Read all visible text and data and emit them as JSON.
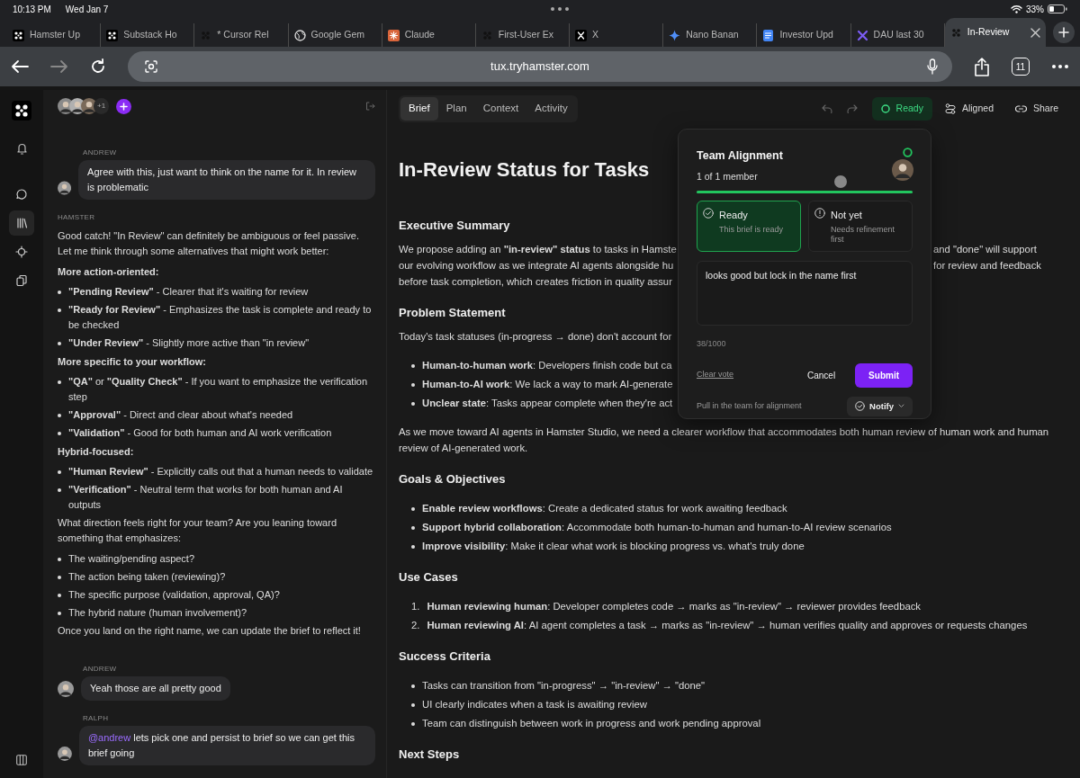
{
  "status_bar": {
    "time": "10:13 PM",
    "date": "Wed Jan 7",
    "battery": "33%"
  },
  "browser_tabs": [
    {
      "title": "Hamster Up",
      "kind": "hamster",
      "selected": false
    },
    {
      "title": "Substack Ho",
      "kind": "hamster",
      "selected": false
    },
    {
      "title": "* Cursor Rel",
      "kind": "hamster-dark",
      "selected": false
    },
    {
      "title": "Google Gem",
      "kind": "globe",
      "selected": false
    },
    {
      "title": "Claude",
      "kind": "claude",
      "selected": false
    },
    {
      "title": "First-User Ex",
      "kind": "hamster-dark",
      "selected": false
    },
    {
      "title": "X",
      "kind": "x",
      "selected": false
    },
    {
      "title": "Nano Banan",
      "kind": "gemini",
      "selected": false
    },
    {
      "title": "Investor Upd",
      "kind": "doc",
      "selected": false
    },
    {
      "title": "DAU last 30",
      "kind": "dau",
      "selected": false
    },
    {
      "title": "In-Review",
      "kind": "hamster-dark",
      "selected": true
    }
  ],
  "address_bar": {
    "url": "tux.tryhamster.com",
    "tab_count": "11"
  },
  "rail": {
    "items": [
      {
        "kind": "chat",
        "selected": false
      },
      {
        "kind": "library",
        "selected": true
      },
      {
        "kind": "target",
        "selected": false
      },
      {
        "kind": "copy",
        "selected": false
      }
    ]
  },
  "chat": {
    "extra_participants": "+1",
    "messages": [
      {
        "kind": "user",
        "author": "ANDREW",
        "text": "Agree with this, just want to think on the name for it. In review is problematic"
      },
      {
        "kind": "assistant",
        "author": "HAMSTER",
        "blocks": [
          {
            "kind": "paragraph",
            "text": "Good catch! \"In Review\" can definitely be ambiguous or feel passive. Let me think through some alternatives that might work better:"
          },
          {
            "kind": "heading",
            "text": "More action-oriented:"
          },
          {
            "kind": "bullets",
            "items": [
              "**\"Pending Review\"** - Clearer that it's waiting for review",
              "**\"Ready for Review\"** - Emphasizes the task is complete and ready to be checked",
              "**\"Under Review\"** - Slightly more active than \"in review\""
            ]
          },
          {
            "kind": "heading",
            "text": "More specific to your workflow:"
          },
          {
            "kind": "bullets",
            "items": [
              "**\"QA\"** or **\"Quality Check\"** - If you want to emphasize the verification step",
              "**\"Approval\"** - Direct and clear about what's needed",
              "**\"Validation\"** - Good for both human and AI work verification"
            ]
          },
          {
            "kind": "heading",
            "text": "Hybrid-focused:"
          },
          {
            "kind": "bullets",
            "items": [
              "**\"Human Review\"** - Explicitly calls out that a human needs to validate",
              "**\"Verification\"** - Neutral term that works for both human and AI outputs"
            ]
          },
          {
            "kind": "paragraph",
            "text": "What direction feels right for your team? Are you leaning toward something that emphasizes:"
          },
          {
            "kind": "bullets",
            "items": [
              "The waiting/pending aspect?",
              "The action being taken (reviewing)?",
              "The specific purpose (validation, approval, QA)?",
              "The hybrid nature (human involvement)?"
            ]
          },
          {
            "kind": "paragraph",
            "text": "Once you land on the right name, we can update the brief to reflect it!"
          }
        ]
      },
      {
        "kind": "user",
        "author": "ANDREW",
        "text": "Yeah those are all pretty good"
      },
      {
        "kind": "user",
        "author": "RALPH",
        "mention": "@andrew",
        "text": "lets pick one and persist to brief so we can get this brief going"
      }
    ]
  },
  "doc": {
    "tabs": [
      {
        "label": "Brief",
        "selected": true
      },
      {
        "label": "Plan",
        "selected": false
      },
      {
        "label": "Context",
        "selected": false
      },
      {
        "label": "Activity",
        "selected": false
      }
    ],
    "status_button": "Ready",
    "aligned_button": "Aligned",
    "share_button": "Share",
    "title": "In-Review Status for Tasks",
    "sections": [
      {
        "heading": "Executive Summary",
        "blocks": [
          {
            "kind": "lines",
            "lines": [
              {
                "left": "We propose adding an **\"in-review\" status** to tasks in Hamste",
                "right": "and \"done\" will support"
              },
              {
                "left": "our evolving workflow as we integrate AI agents alongside hu",
                "right": "for review and feedback"
              },
              {
                "left": "before task completion, which creates friction in quality assur"
              }
            ]
          }
        ]
      },
      {
        "heading": "Problem Statement",
        "blocks": [
          {
            "kind": "lines",
            "lines": [
              {
                "left": "Today's task statuses (in-progress → done) don't account for"
              }
            ]
          },
          {
            "kind": "bullets",
            "items": [
              "**Human-to-human work**: Developers finish code but ca",
              "**Human-to-AI work**: We lack a way to mark AI-generate",
              "**Unclear state**: Tasks appear complete when they're act"
            ]
          },
          {
            "kind": "paragraph",
            "text": "As we move toward AI agents in Hamster Studio, we need a clearer workflow that accommodates both human review of human work and human review of AI-generated work."
          }
        ]
      },
      {
        "heading": "Goals & Objectives",
        "blocks": [
          {
            "kind": "bullets",
            "items": [
              "**Enable review workflows**: Create a dedicated status for work awaiting feedback",
              "**Support hybrid collaboration**: Accommodate both human-to-human and human-to-AI review scenarios",
              "**Improve visibility**: Make it clear what work is blocking progress vs. what's truly done"
            ]
          }
        ]
      },
      {
        "heading": "Use Cases",
        "blocks": [
          {
            "kind": "numbered",
            "items": [
              {
                "number": "1.",
                "text": "**Human reviewing human**: Developer completes code → marks as \"in-review\" → reviewer provides feedback"
              },
              {
                "number": "2.",
                "text": "**Human reviewing AI**: AI agent completes a task → marks as \"in-review\" → human verifies quality and approves or requests changes"
              }
            ]
          }
        ]
      },
      {
        "heading": "Success Criteria",
        "blocks": [
          {
            "kind": "bullets",
            "items": [
              "Tasks can transition from \"in-progress\" → \"in-review\" → \"done\"",
              "UI clearly indicates when a task is awaiting review",
              "Team can distinguish between work in progress and work pending approval"
            ]
          }
        ]
      },
      {
        "heading": "Next Steps"
      }
    ]
  },
  "alignment": {
    "title": "Team Alignment",
    "count": "1 of 1 member",
    "level": 1,
    "options": [
      {
        "kind": "check",
        "label": "Ready",
        "sub": "This brief is ready",
        "selected": true
      },
      {
        "kind": "alert",
        "label": "Not yet",
        "sub": "Needs refinement first",
        "selected": false
      }
    ],
    "comment": "looks good but lock in the name first",
    "counter": "38/1000",
    "clear": "Clear vote",
    "cancel": "Cancel",
    "submit": "Submit",
    "footer": "Pull in the team for alignment",
    "notify": "Notify"
  }
}
